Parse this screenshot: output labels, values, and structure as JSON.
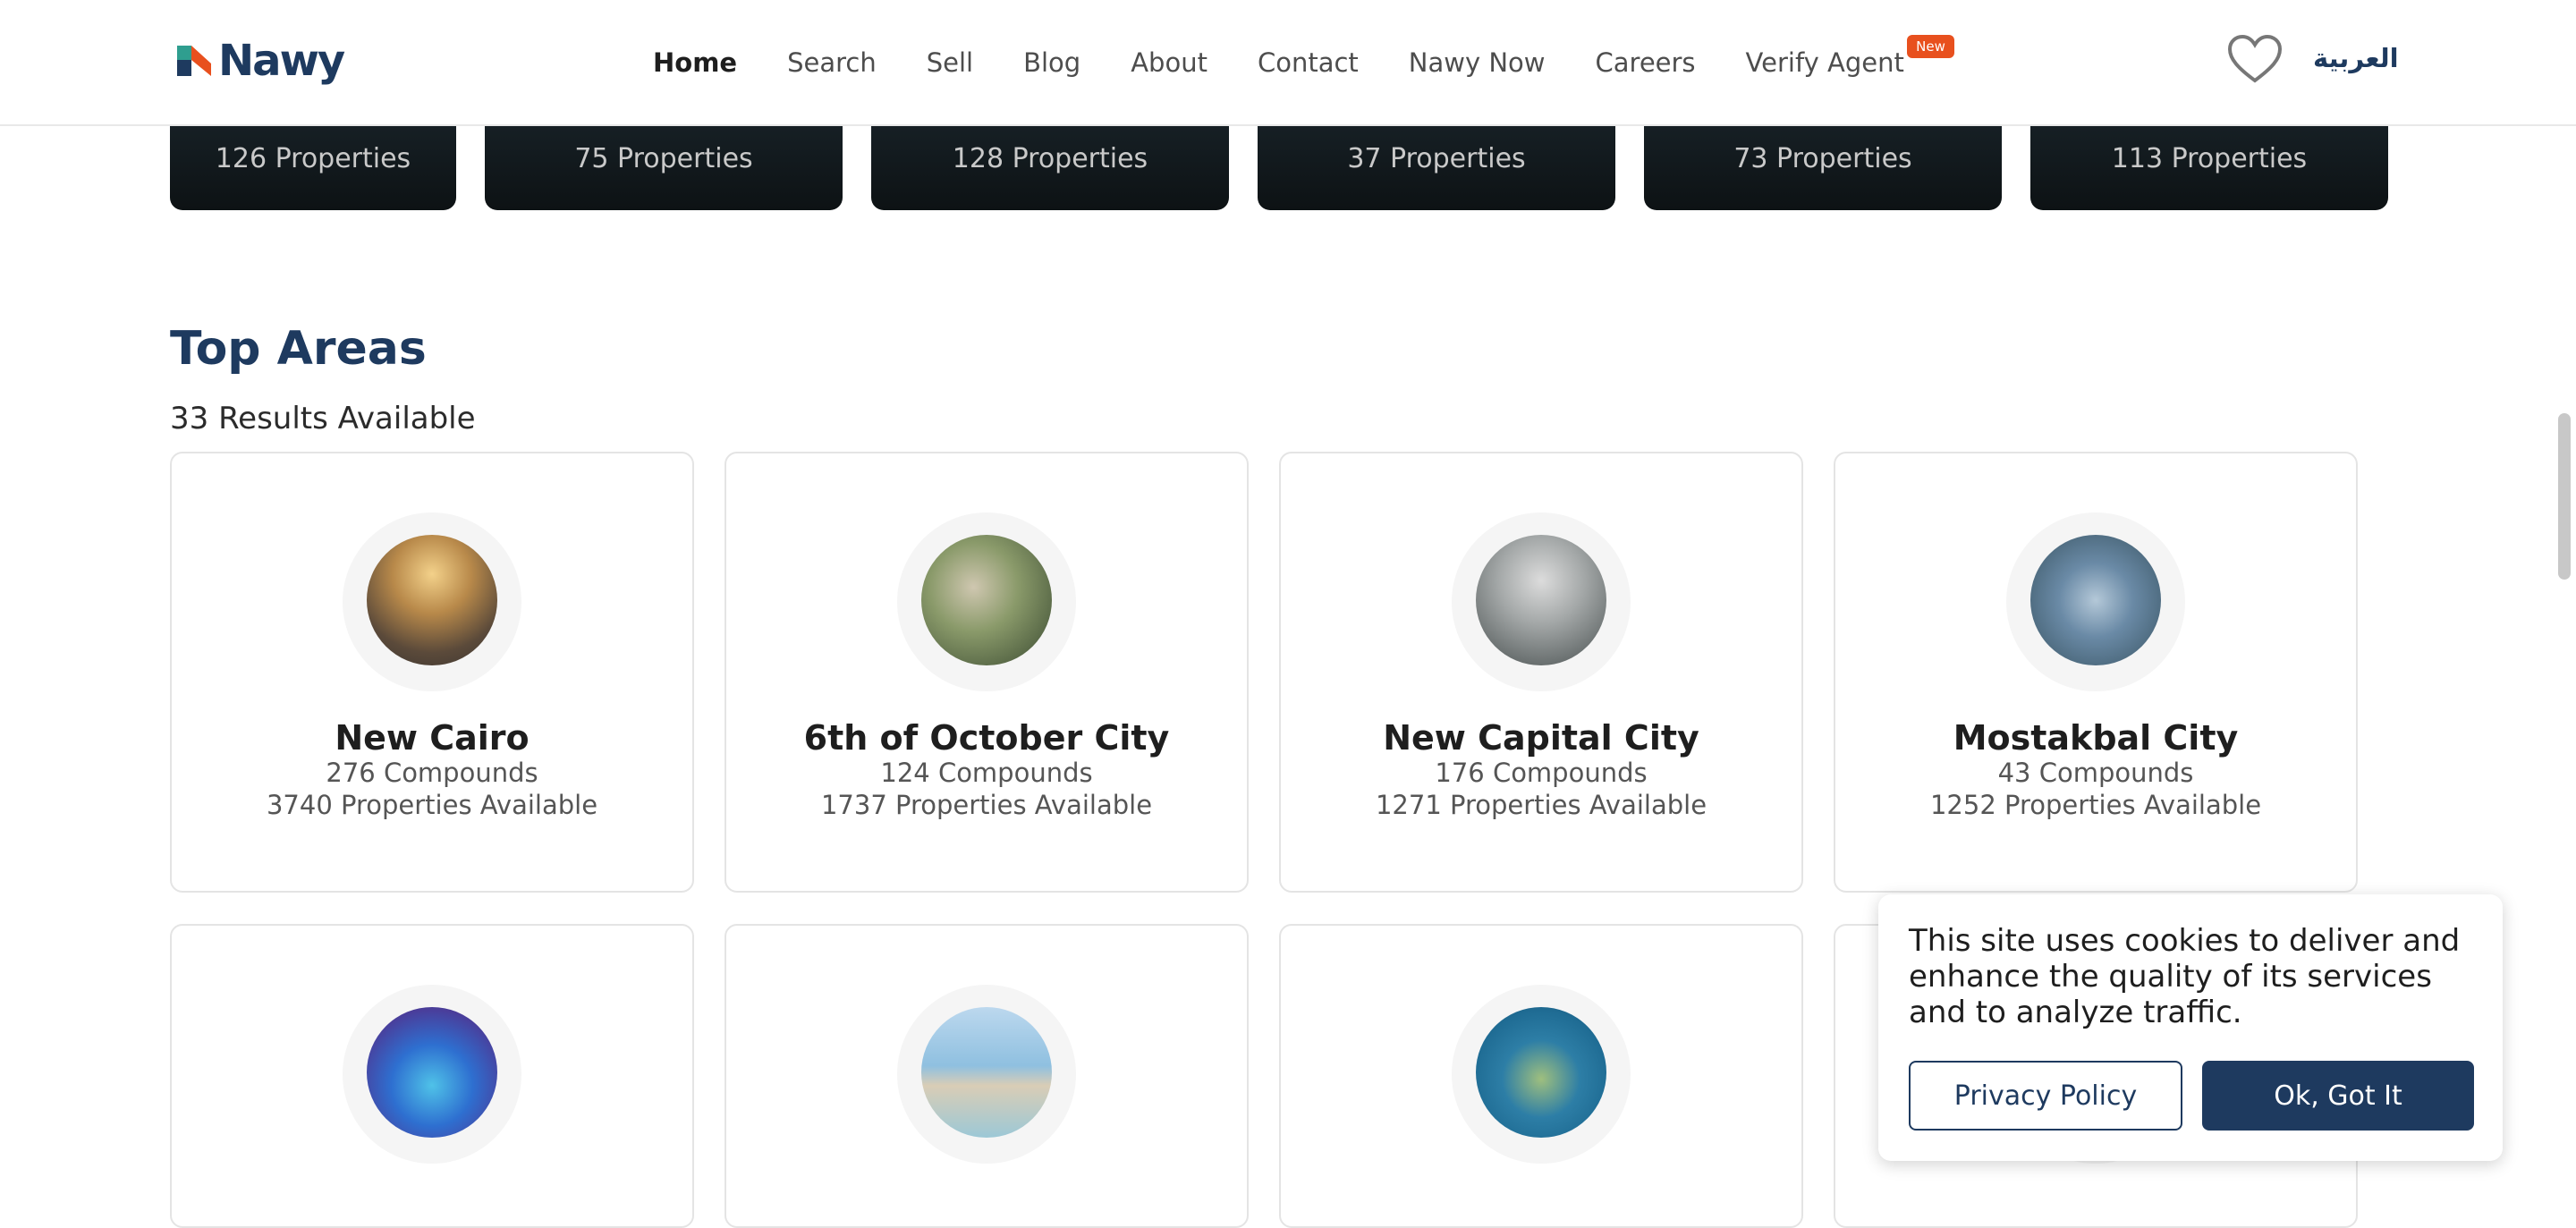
{
  "header": {
    "logo_text": "Nawy",
    "nav": [
      "Home",
      "Search",
      "Sell",
      "Blog",
      "About",
      "Contact",
      "Nawy Now",
      "Careers",
      "Verify Agent"
    ],
    "new_badge": "New",
    "language": "العربية"
  },
  "properties_strip": [
    "126 Properties",
    "75 Properties",
    "128 Properties",
    "37 Properties",
    "73 Properties",
    "113 Properties"
  ],
  "top_areas": {
    "title": "Top Areas",
    "results": "33 Results Available",
    "areas": [
      {
        "name": "New Cairo",
        "compounds": "276 Compounds",
        "available": "3740 Properties Available"
      },
      {
        "name": "6th of October City",
        "compounds": "124 Compounds",
        "available": "1737 Properties Available"
      },
      {
        "name": "New Capital City",
        "compounds": "176 Compounds",
        "available": "1271 Properties Available"
      },
      {
        "name": "Mostakbal City",
        "compounds": "43 Compounds",
        "available": "1252 Properties Available"
      }
    ]
  },
  "cookie": {
    "text": "This site uses cookies to deliver and enhance the quality of its services and to analyze traffic.",
    "privacy_label": "Privacy Policy",
    "ok_label": "Ok, Got It"
  },
  "colors": {
    "brand": "#1e3a5f",
    "badge": "#e8501e"
  }
}
